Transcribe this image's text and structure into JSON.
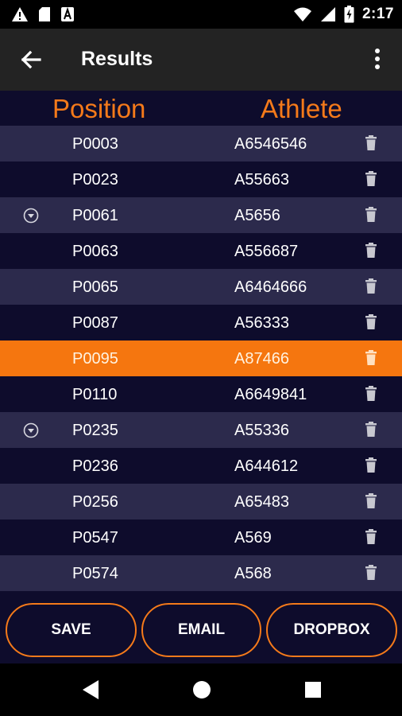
{
  "status_bar": {
    "time": "2:17",
    "icons": [
      "warning-icon",
      "sd-card-icon",
      "font-a-icon",
      "wifi-icon",
      "signal-icon",
      "battery-icon"
    ]
  },
  "app_bar": {
    "title": "Results",
    "back_icon": "arrow-left-icon",
    "menu_icon": "more-vert-icon"
  },
  "table": {
    "headers": {
      "position": "Position",
      "athlete": "Athlete"
    },
    "rows": [
      {
        "position": "P0003",
        "athlete": "A6546546",
        "expandable": false,
        "selected": false
      },
      {
        "position": "P0023",
        "athlete": "A55663",
        "expandable": false,
        "selected": false
      },
      {
        "position": "P0061",
        "athlete": "A5656",
        "expandable": true,
        "selected": false
      },
      {
        "position": "P0063",
        "athlete": "A556687",
        "expandable": false,
        "selected": false
      },
      {
        "position": "P0065",
        "athlete": "A6464666",
        "expandable": false,
        "selected": false
      },
      {
        "position": "P0087",
        "athlete": "A56333",
        "expandable": false,
        "selected": false
      },
      {
        "position": "P0095",
        "athlete": "A87466",
        "expandable": false,
        "selected": true
      },
      {
        "position": "P0110",
        "athlete": "A6649841",
        "expandable": false,
        "selected": false
      },
      {
        "position": "P0235",
        "athlete": "A55336",
        "expandable": true,
        "selected": false
      },
      {
        "position": "P0236",
        "athlete": "A644612",
        "expandable": false,
        "selected": false
      },
      {
        "position": "P0256",
        "athlete": "A65483",
        "expandable": false,
        "selected": false
      },
      {
        "position": "P0547",
        "athlete": "A569",
        "expandable": false,
        "selected": false
      },
      {
        "position": "P0574",
        "athlete": "A568",
        "expandable": false,
        "selected": false
      }
    ]
  },
  "actions": {
    "save": "SAVE",
    "email": "EMAIL",
    "dropbox": "DROPBOX"
  },
  "colors": {
    "accent": "#f57a1a",
    "selected_row": "#f5760f",
    "row_light": "#2c2a4c",
    "row_dark": "#0e0c2c",
    "app_bar": "#232323"
  }
}
